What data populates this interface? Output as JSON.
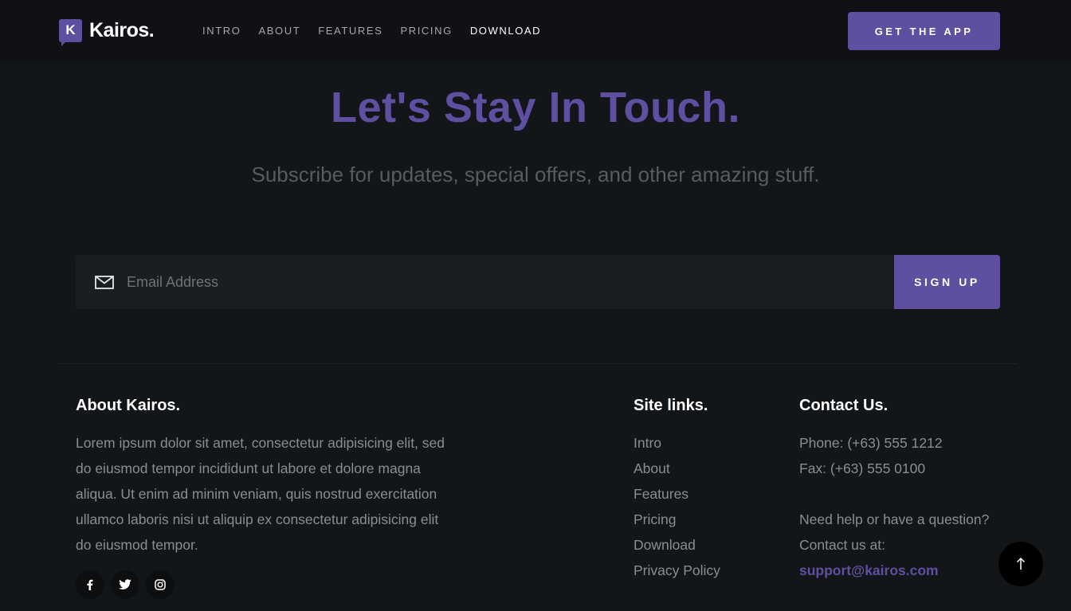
{
  "header": {
    "logo_letter": "K",
    "logo_text": "Kairos.",
    "nav": [
      "INTRO",
      "ABOUT",
      "FEATURES",
      "PRICING",
      "DOWNLOAD"
    ],
    "active_nav": "DOWNLOAD",
    "cta_label": "GET THE APP"
  },
  "hero": {
    "title": "Let's Stay In Touch.",
    "subtitle": "Subscribe for updates, special offers, and other amazing stuff."
  },
  "subscribe": {
    "placeholder": "Email Address",
    "button_label": "SIGN UP",
    "mail_icon": "mail-icon"
  },
  "footer": {
    "about": {
      "title": "About Kairos.",
      "text": "Lorem ipsum dolor sit amet, consectetur adipisicing elit, sed do eiusmod tempor incididunt ut labore et dolore magna aliqua. Ut enim ad minim veniam, quis nostrud exercitation ullamco laboris nisi ut aliquip ex consectetur adipisicing elit do eiusmod tempor.",
      "socials": [
        "facebook-icon",
        "twitter-icon",
        "instagram-icon"
      ]
    },
    "links": {
      "title": "Site links.",
      "items": [
        "Intro",
        "About",
        "Features",
        "Pricing",
        "Download",
        "Privacy Policy"
      ]
    },
    "contact": {
      "title": "Contact Us.",
      "phone": "Phone: (+63) 555 1212",
      "fax": "Fax: (+63) 555 0100",
      "help": "Need help or have a question?",
      "contact_at": "Contact us at:",
      "email": "support@kairos.com"
    }
  },
  "colors": {
    "accent": "#5f4fa0",
    "background": "#131619",
    "header_bg": "#0f1114"
  },
  "back_to_top_icon": "arrow-up-icon"
}
